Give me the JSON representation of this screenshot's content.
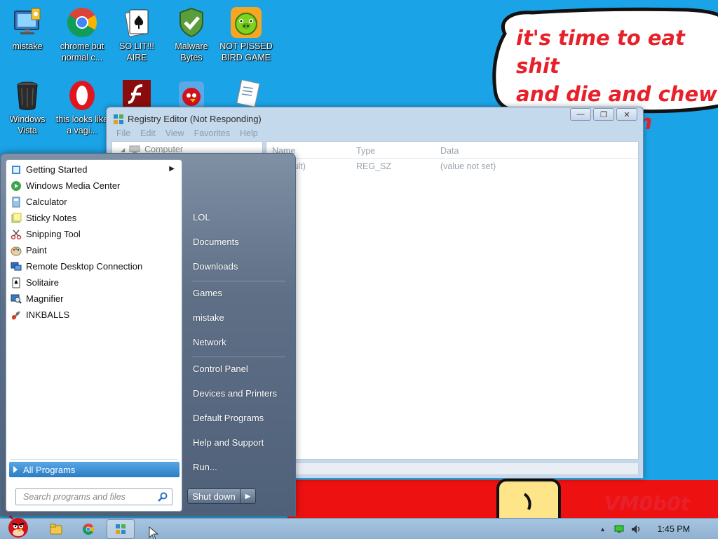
{
  "desktop": {
    "icons": [
      {
        "label": "mistake",
        "icon": "monitor-icon"
      },
      {
        "label": "chrome but normal c...",
        "icon": "chrome-icon"
      },
      {
        "label": "SO LIT!!! AIRE",
        "icon": "solitaire-card-icon"
      },
      {
        "label": "Malware Bytes",
        "icon": "shield-check-icon"
      },
      {
        "label": "NOT PISSED BIRD GAME",
        "icon": "green-pig-icon"
      },
      {
        "label": "Windows Vista",
        "icon": "recycle-bin-icon"
      },
      {
        "label": "this looks like a vagi...",
        "icon": "opera-icon"
      },
      {
        "label": "",
        "icon": "flash-icon"
      },
      {
        "label": "",
        "icon": "angry-bird-icon"
      },
      {
        "label": "",
        "icon": "document-icon"
      }
    ],
    "bubble_text": "it's time to eat shit\nand die and chew\nbubble gum",
    "watermark": "VM0b0t",
    "colors": {
      "background": "#1aa3e6",
      "bubble_text": "#e8202a"
    }
  },
  "regedit": {
    "title": "Registry Editor (Not Responding)",
    "menu": [
      "File",
      "Edit",
      "View",
      "Favorites",
      "Help"
    ],
    "tree_root": "Computer",
    "columns": [
      "Name",
      "Type",
      "Data"
    ],
    "rows": [
      {
        "name": "(Default)",
        "type": "REG_SZ",
        "data": "(value not set)"
      }
    ]
  },
  "start_menu": {
    "programs": [
      {
        "label": "Getting Started",
        "icon": "getting-started-icon",
        "has_submenu": true
      },
      {
        "label": "Windows Media Center",
        "icon": "media-center-icon"
      },
      {
        "label": "Calculator",
        "icon": "calculator-icon"
      },
      {
        "label": "Sticky Notes",
        "icon": "sticky-notes-icon"
      },
      {
        "label": "Snipping Tool",
        "icon": "scissors-icon"
      },
      {
        "label": "Paint",
        "icon": "paint-palette-icon"
      },
      {
        "label": "Remote Desktop Connection",
        "icon": "remote-desktop-icon"
      },
      {
        "label": "Solitaire",
        "icon": "solitaire-icon"
      },
      {
        "label": "Magnifier",
        "icon": "magnifier-icon"
      },
      {
        "label": "INKBALLS",
        "icon": "inkball-icon"
      }
    ],
    "all_programs": "All Programs",
    "search_placeholder": "Search programs and files",
    "places": [
      "LOL",
      "Documents",
      "Downloads",
      "Games",
      "mistake",
      "Network",
      "Control Panel",
      "Devices and Printers",
      "Default Programs",
      "Help and Support",
      "Run..."
    ],
    "shutdown": "Shut down"
  },
  "taskbar": {
    "clock": "1:45 PM",
    "pinned": [
      "angry-bird-start-icon",
      "explorer-icon",
      "chrome-icon",
      "regedit-icon"
    ]
  }
}
